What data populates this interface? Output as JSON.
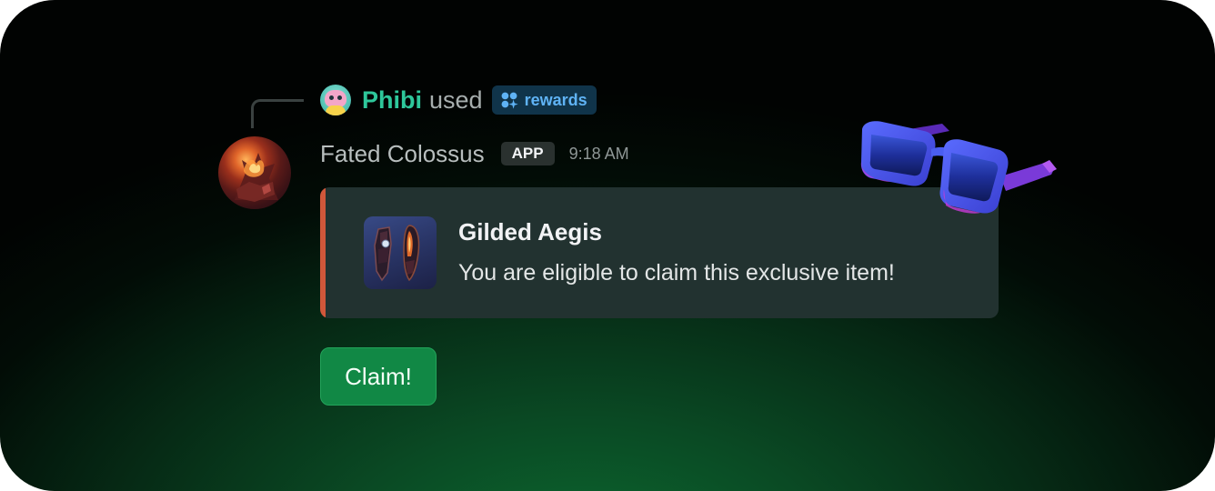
{
  "reply": {
    "user_name": "Phibi",
    "action_text": "used",
    "command_label": "rewards",
    "user_color": "#2ec79b",
    "command_color": "#5fb3f5"
  },
  "message": {
    "author_name": "Fated Colossus",
    "badge_label": "APP",
    "timestamp": "9:18 AM"
  },
  "embed": {
    "title": "Gilded Aegis",
    "description": "You are eligible to claim this exclusive item!",
    "accent_color": "#d0573a"
  },
  "actions": {
    "claim_label": "Claim!",
    "claim_color": "#118845"
  },
  "icons": {
    "reply_avatar": "frog-avatar-icon",
    "command_icon": "rewards-sparkle-icon",
    "author_avatar": "fire-warrior-avatar",
    "item_thumbnail": "gauntlets-item-icon",
    "decoration": "sunglasses-icon"
  }
}
